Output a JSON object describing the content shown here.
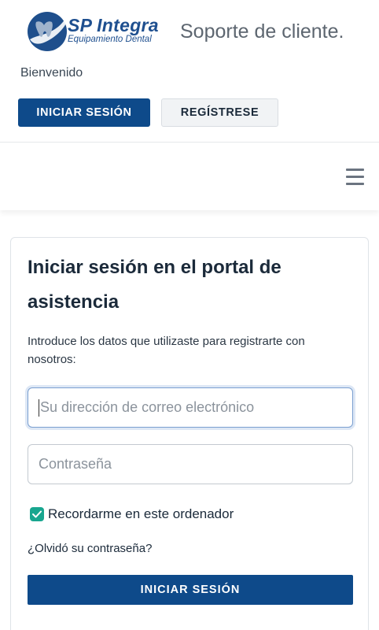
{
  "header": {
    "logo_name": "SP Integra",
    "logo_sub": "Equipamiento Dental",
    "title": "Soporte de cliente.",
    "welcome": "Bienvenido",
    "login_label": "INICIAR SESIÓN",
    "register_label": "REGÍSTRESE"
  },
  "nav": {
    "menu_icon": "hamburger-menu-icon"
  },
  "login_form": {
    "title": "Iniciar sesión en el portal de asistencia",
    "description": "Introduce los datos que utilizaste para registrarte con nosotros:",
    "email_placeholder": "Su dirección de correo electrónico",
    "email_value": "",
    "password_placeholder": "Contraseña",
    "password_value": "",
    "remember_label": "Recordarme en este ordenador",
    "remember_checked": true,
    "forgot_label": "¿Olvidó su contraseña?",
    "submit_label": "INICIAR SESIÓN"
  },
  "colors": {
    "primary": "#0e4a8a",
    "checkbox": "#18a68f",
    "brand": "#1e4f8f"
  }
}
